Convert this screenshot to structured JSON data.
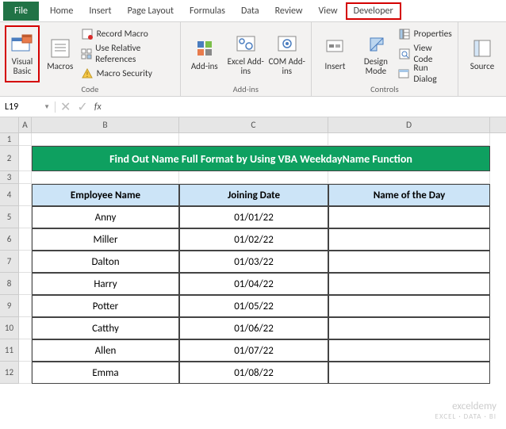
{
  "ribbon": {
    "tabs": {
      "file": "File",
      "home": "Home",
      "insert": "Insert",
      "pagelayout": "Page Layout",
      "formulas": "Formulas",
      "data": "Data",
      "review": "Review",
      "view": "View",
      "developer": "Developer"
    },
    "groups": {
      "code": {
        "label": "Code",
        "visual_basic": "Visual Basic",
        "macros": "Macros",
        "record_macro": "Record Macro",
        "use_relative": "Use Relative References",
        "macro_security": "Macro Security"
      },
      "addins": {
        "label": "Add-ins",
        "addins_btn": "Add-ins",
        "excel_addins": "Excel Add-ins",
        "com_addins": "COM Add-ins"
      },
      "controls": {
        "label": "Controls",
        "insert": "Insert",
        "design_mode": "Design Mode",
        "properties": "Properties",
        "view_code": "View Code",
        "run_dialog": "Run Dialog"
      },
      "xml": {
        "source": "Source"
      }
    }
  },
  "formula_bar": {
    "name_box": "L19",
    "fx": "fx"
  },
  "columns": {
    "A": "A",
    "B": "B",
    "C": "C",
    "D": "D"
  },
  "row_labels": [
    "1",
    "2",
    "3",
    "4",
    "5",
    "6",
    "7",
    "8",
    "9",
    "10",
    "11",
    "12"
  ],
  "title": "Find Out  Name Full Format by Using VBA WeekdayName Function",
  "headers": {
    "emp": "Employee Name",
    "join": "Joining Date",
    "day": "Name of the Day"
  },
  "chart_data": {
    "type": "table",
    "columns": [
      "Employee Name",
      "Joining Date",
      "Name of the Day"
    ],
    "rows": [
      {
        "emp": "Anny",
        "join": "01/01/22",
        "day": ""
      },
      {
        "emp": "Miller",
        "join": "01/02/22",
        "day": ""
      },
      {
        "emp": "Dalton",
        "join": "01/03/22",
        "day": ""
      },
      {
        "emp": "Harry",
        "join": "01/04/22",
        "day": ""
      },
      {
        "emp": "Potter",
        "join": "01/05/22",
        "day": ""
      },
      {
        "emp": "Catthy",
        "join": "01/06/22",
        "day": ""
      },
      {
        "emp": "Allen",
        "join": "01/07/22",
        "day": ""
      },
      {
        "emp": "Emma",
        "join": "01/08/22",
        "day": ""
      }
    ]
  },
  "watermark": {
    "main": "exceldemy",
    "sub": "EXCEL · DATA · BI"
  }
}
